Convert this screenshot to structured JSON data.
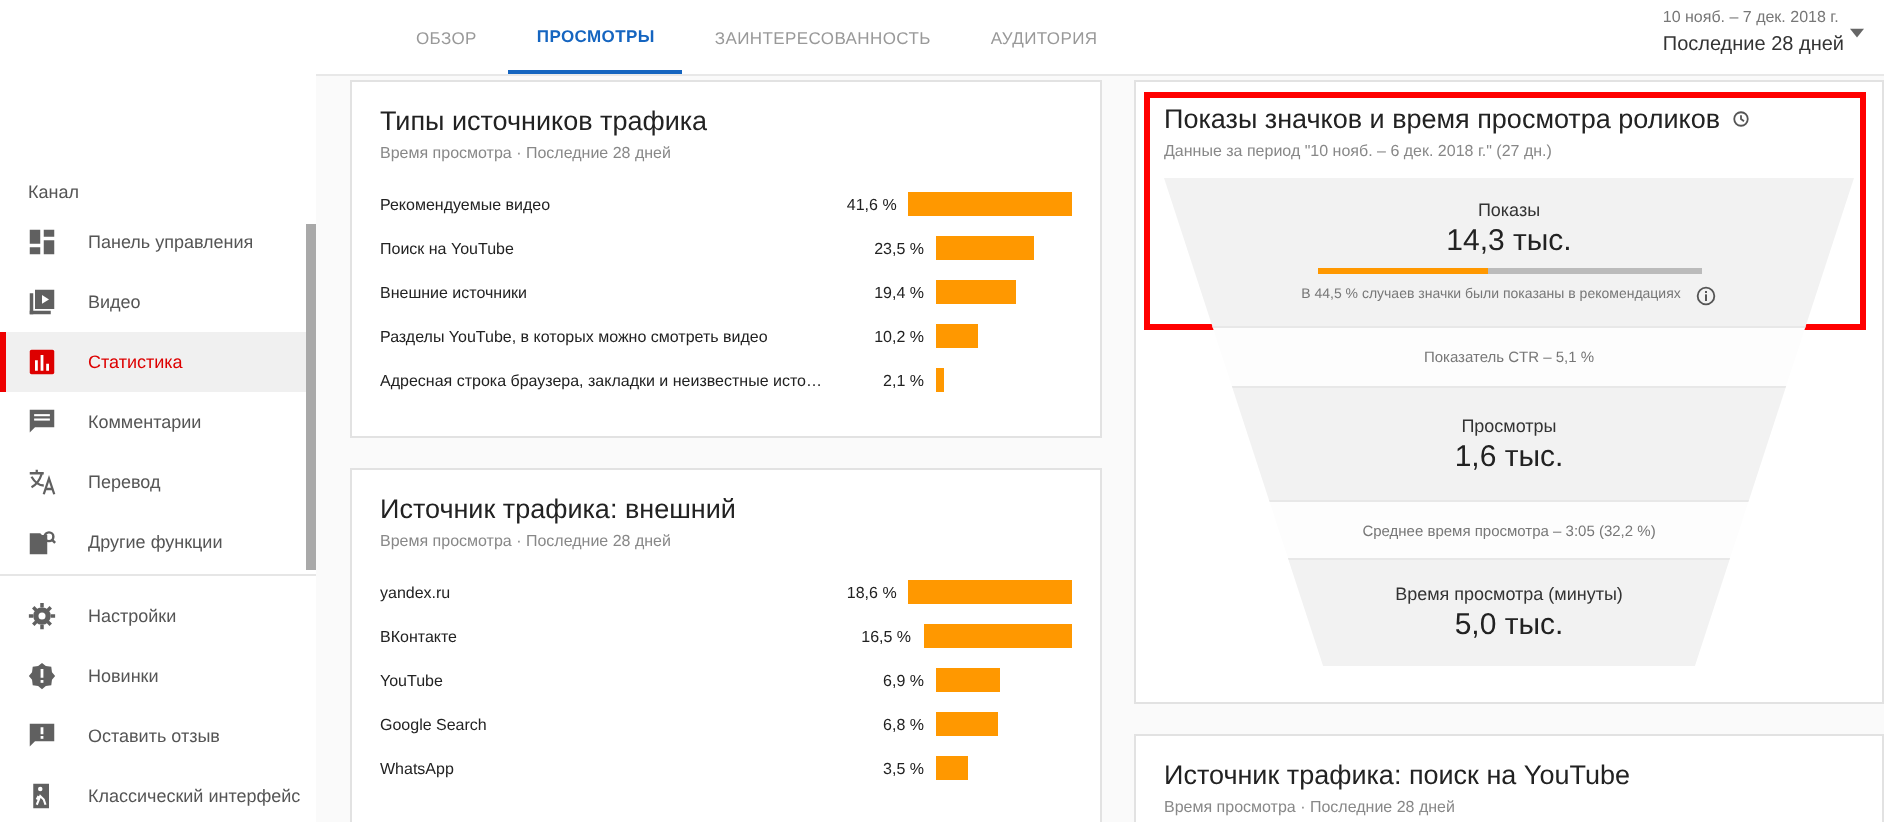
{
  "sidebar": {
    "section": "Канал",
    "items": [
      {
        "label": "Панель управления",
        "selected": false
      },
      {
        "label": "Видео",
        "selected": false
      },
      {
        "label": "Статистика",
        "selected": true
      },
      {
        "label": "Комментарии",
        "selected": false
      },
      {
        "label": "Перевод",
        "selected": false
      },
      {
        "label": "Другие функции",
        "selected": false
      }
    ],
    "footer_items": [
      {
        "label": "Настройки"
      },
      {
        "label": "Новинки"
      },
      {
        "label": "Оставить отзыв"
      },
      {
        "label": "Классический интерфейс"
      }
    ]
  },
  "tabs": [
    {
      "label": "ОБЗОР",
      "selected": false
    },
    {
      "label": "ПРОСМОТРЫ",
      "selected": true
    },
    {
      "label": "ЗАИНТЕРЕСОВАННОСТЬ",
      "selected": false
    },
    {
      "label": "АУДИТОРИЯ",
      "selected": false
    }
  ],
  "date_range": {
    "range": "10 нояб. – 7 дек. 2018 г.",
    "label": "Последние 28 дней"
  },
  "traffic_types": {
    "title": "Типы источников трафика",
    "subtitle": "Время просмотра · Последние 28 дней",
    "rows": [
      {
        "label": "Рекомендуемые видео",
        "value": "41,6 %"
      },
      {
        "label": "Поиск на YouTube",
        "value": "23,5 %"
      },
      {
        "label": "Внешние источники",
        "value": "19,4 %"
      },
      {
        "label": "Разделы YouTube, в которых можно смотреть видео",
        "value": "10,2 %"
      },
      {
        "label": "Адресная строка браузера, закладки и неизвестные исто…",
        "value": "2,1 %"
      }
    ]
  },
  "external": {
    "title": "Источник трафика: внешний",
    "subtitle": "Время просмотра · Последние 28 дней",
    "rows": [
      {
        "label": "yandex.ru",
        "value": "18,6 %"
      },
      {
        "label": "ВКонтакте",
        "value": "16,5 %"
      },
      {
        "label": "YouTube",
        "value": "6,9 %"
      },
      {
        "label": "Google Search",
        "value": "6,8 %"
      },
      {
        "label": "WhatsApp",
        "value": "3,5 %"
      }
    ]
  },
  "funnel": {
    "title": "Показы значков и время просмотра роликов",
    "subtitle": "Данные за период \"10 нояб. – 6 дек. 2018 г.\" (27 дн.)",
    "impressions": {
      "label": "Показы",
      "value": "14,3 тыс.",
      "level": 0.445,
      "note": "В 44,5 % случаев значки были показаны в рекомендациях"
    },
    "ctr": "Показатель CTR – 5,1 %",
    "views": {
      "label": "Просмотры",
      "value": "1,6 тыс."
    },
    "avg": "Среднее время просмотра – 3:05 (32,2 %)",
    "watch": {
      "label": "Время просмотра (минуты)",
      "value": "5,0 тыс."
    }
  },
  "youtube_search": {
    "title": "Источник трафика: поиск на YouTube",
    "subtitle": "Время просмотра · Последние 28 дней"
  }
}
